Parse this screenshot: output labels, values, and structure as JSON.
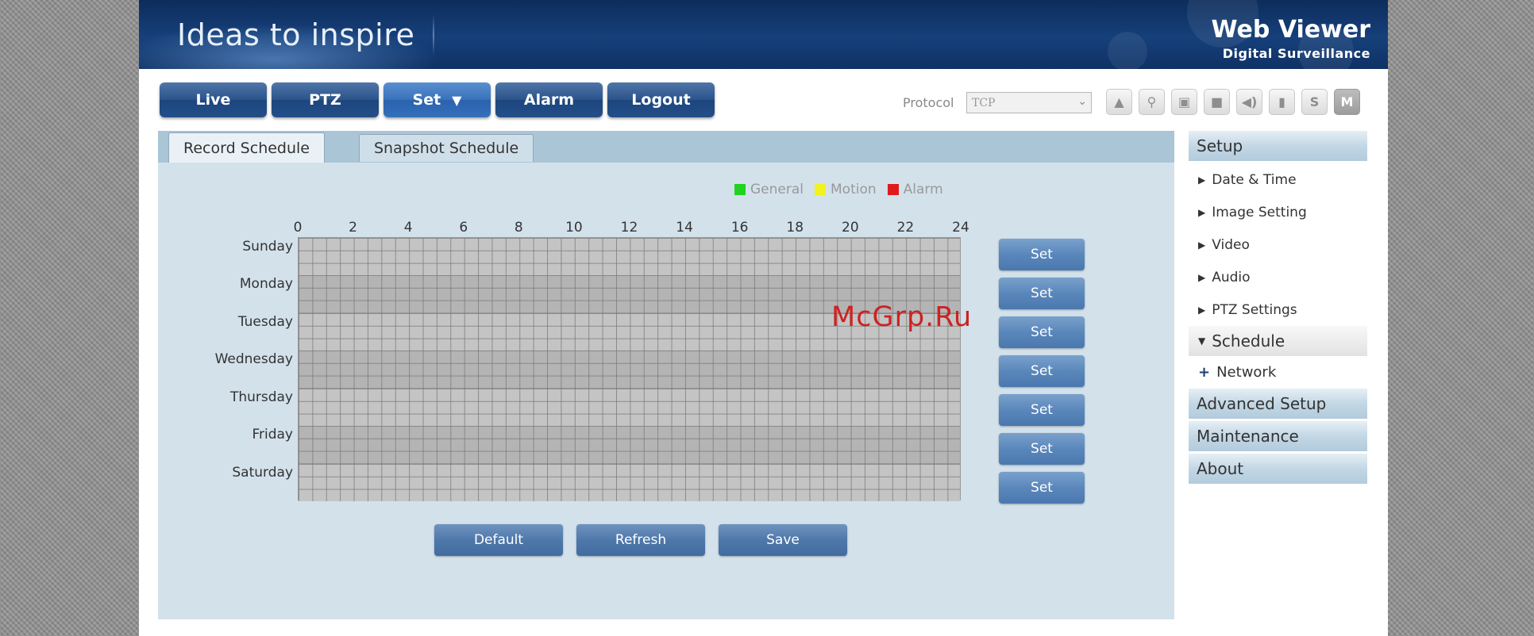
{
  "header": {
    "slogan": "Ideas to inspire",
    "brand_title": "Web Viewer",
    "brand_subtitle": "Digital Surveillance"
  },
  "nav": [
    {
      "label": "Live",
      "active": false
    },
    {
      "label": "PTZ",
      "active": false
    },
    {
      "label": "Set",
      "active": true,
      "dropdown_arrow": "▼"
    },
    {
      "label": "Alarm",
      "active": false
    },
    {
      "label": "Logout",
      "active": false
    }
  ],
  "protocol": {
    "label": "Protocol",
    "value": "TCP"
  },
  "toolbar": [
    {
      "icon": "alarm-warning-icon",
      "glyph": "▲"
    },
    {
      "icon": "zoom-icon",
      "glyph": "⚲"
    },
    {
      "icon": "snapshot-icon",
      "glyph": "▣"
    },
    {
      "icon": "record-icon",
      "glyph": "■"
    },
    {
      "icon": "speaker-icon",
      "glyph": "◀)"
    },
    {
      "icon": "microphone-icon",
      "glyph": "▮"
    },
    {
      "icon": "stream-s-icon",
      "glyph": "S"
    },
    {
      "icon": "stream-m-icon",
      "glyph": "M"
    }
  ],
  "tabs": [
    {
      "label": "Record Schedule",
      "active": true
    },
    {
      "label": "Snapshot Schedule",
      "active": false
    }
  ],
  "legend": [
    {
      "label": "General",
      "color": "#1fd31f"
    },
    {
      "label": "Motion",
      "color": "#f2f21c"
    },
    {
      "label": "Alarm",
      "color": "#e01b1b"
    }
  ],
  "hours": [
    "0",
    "2",
    "4",
    "6",
    "8",
    "10",
    "12",
    "14",
    "16",
    "18",
    "20",
    "22",
    "24"
  ],
  "days": [
    "Sunday",
    "Monday",
    "Tuesday",
    "Wednesday",
    "Thursday",
    "Friday",
    "Saturday"
  ],
  "day_set_label": "Set",
  "actions": {
    "default_label": "Default",
    "refresh_label": "Refresh",
    "save_label": "Save"
  },
  "sidebar": {
    "setup_label": "Setup",
    "items": [
      {
        "label": "Date & Time"
      },
      {
        "label": "Image Setting"
      },
      {
        "label": "Video"
      },
      {
        "label": "Audio"
      },
      {
        "label": "PTZ Settings"
      }
    ],
    "schedule_label": "Schedule",
    "network_label": "Network",
    "sections": [
      "Advanced Setup",
      "Maintenance",
      "About"
    ]
  },
  "watermark": "McGrp.Ru"
}
